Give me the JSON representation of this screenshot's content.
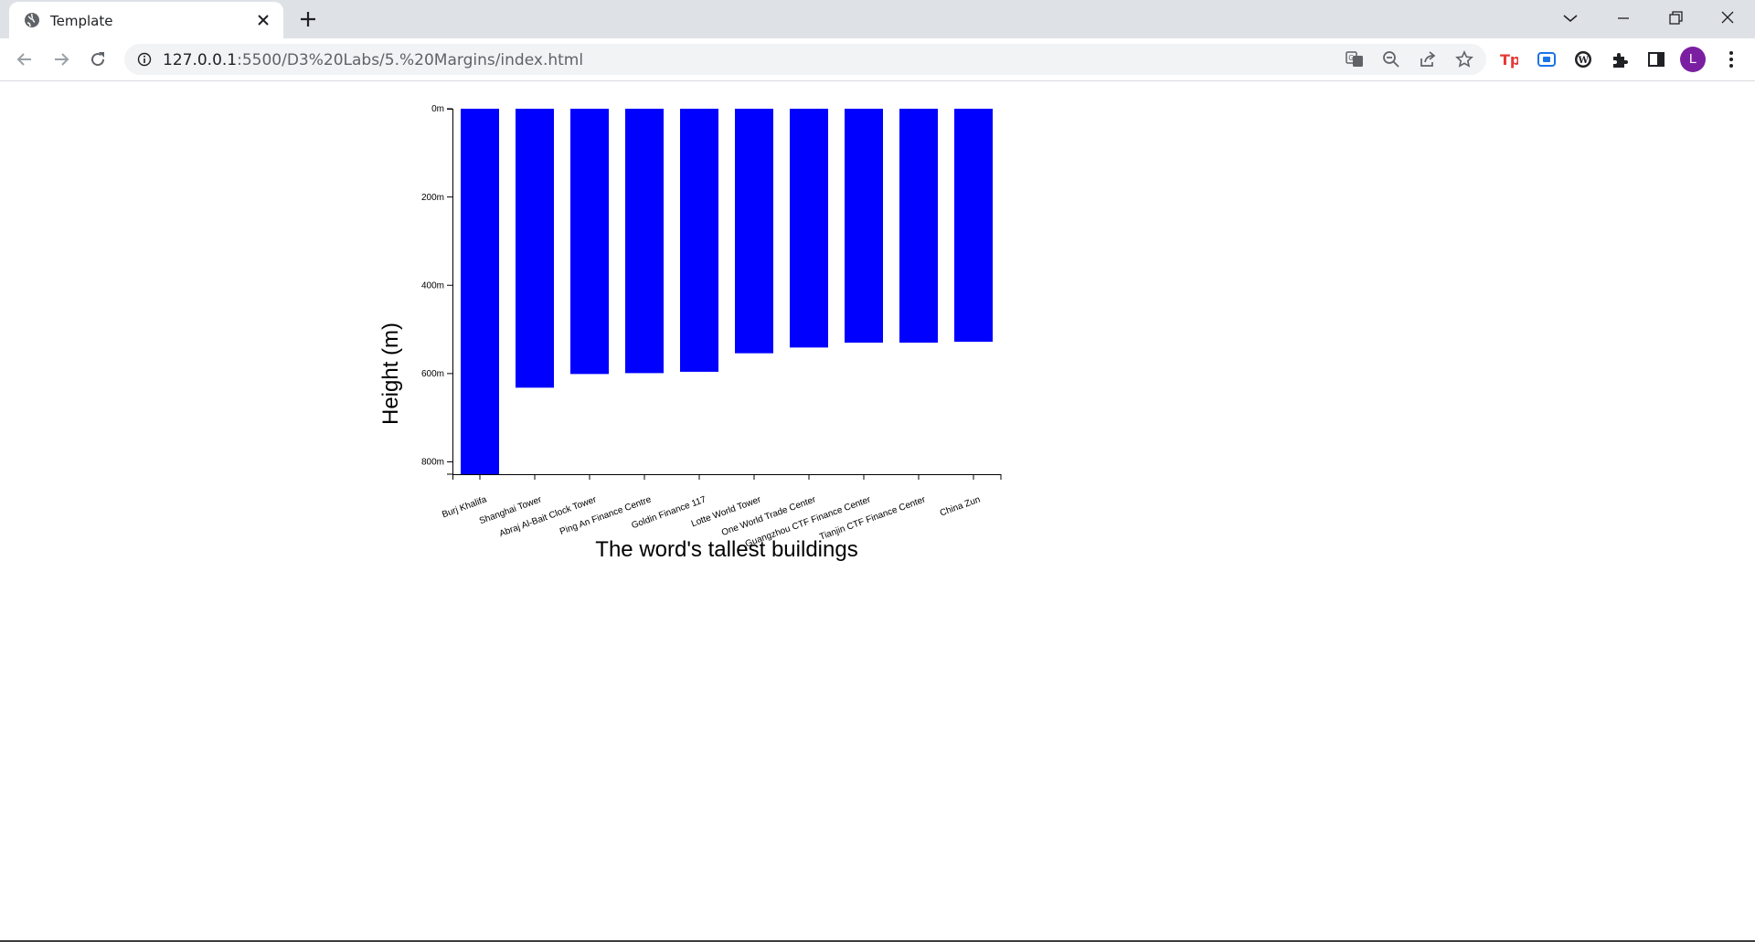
{
  "tab": {
    "title": "Template"
  },
  "address_bar": {
    "url_host": "127.0.0.1",
    "url_path": ":5500/D3%20Labs/5.%20Margins/index.html"
  },
  "profile": {
    "initial": "L",
    "color": "#7b1fa2"
  },
  "icons": {
    "tab": [
      "globe-icon",
      "close-icon",
      "plus-icon"
    ],
    "window": [
      "chevron-down-icon",
      "minimize-icon",
      "restore-icon",
      "close-window-icon"
    ],
    "nav": [
      "back-arrow-icon",
      "forward-arrow-icon",
      "reload-icon",
      "info-icon"
    ],
    "omnibox": [
      "translate-icon",
      "zoom-out-icon",
      "share-icon",
      "star-icon"
    ],
    "extensions": [
      "tp-extension-icon",
      "screen-capture-extension-icon",
      "wordpress-extension-icon",
      "puzzle-icon",
      "side-panel-icon",
      "kebab-menu-icon"
    ]
  },
  "chart_data": {
    "type": "bar",
    "title": "",
    "xlabel": "The word's tallest buildings",
    "ylabel": "Height (m)",
    "bar_color": "#0000ff",
    "ylim": [
      0,
      828
    ],
    "y_ticks": [
      0,
      200,
      400,
      600,
      800
    ],
    "y_tick_suffix": "m",
    "categories": [
      "Burj Khalifa",
      "Shanghai Tower",
      "Abraj Al-Bait Clock Tower",
      "Ping An Finance Centre",
      "Goldin Finance 117",
      "Lotte World Tower",
      "One World Trade Center",
      "Guangzhou CTF Finance Center",
      "Tianjin CTF Finance Center",
      "China Zun"
    ],
    "values": [
      828,
      632,
      601,
      599,
      596,
      554,
      541,
      530,
      530,
      528
    ]
  }
}
